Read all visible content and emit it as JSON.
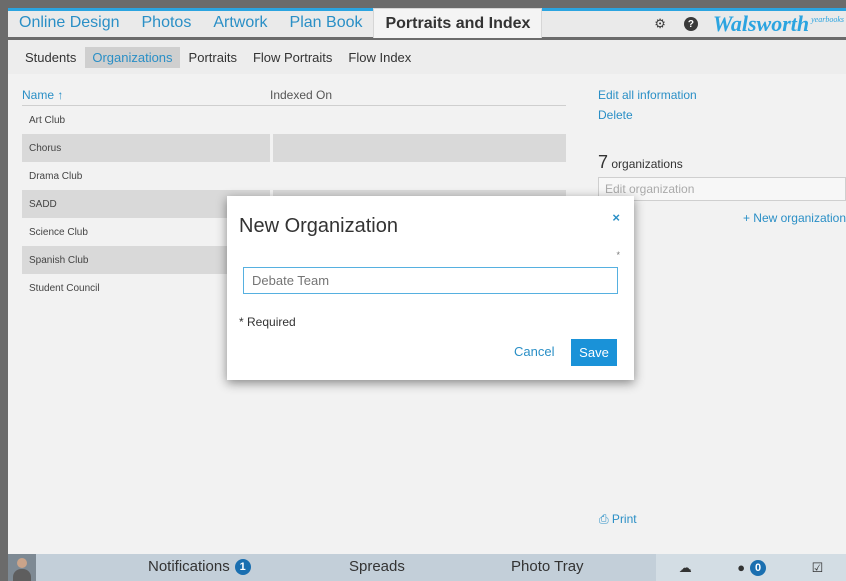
{
  "topnav": {
    "tabs": [
      "Online Design",
      "Photos",
      "Artwork",
      "Plan Book",
      "Portraits and Index"
    ],
    "active_tab": "Portraits and Index",
    "brand": "Walsworth",
    "brand_sub": "yearbooks",
    "icons": [
      "gear-icon",
      "help-icon"
    ]
  },
  "subnav": {
    "tabs": [
      "Students",
      "Organizations",
      "Portraits",
      "Flow Portraits",
      "Flow Index"
    ],
    "active_tab": "Organizations"
  },
  "table": {
    "headers": [
      "Name ↑",
      "Indexed On"
    ],
    "rows": [
      "Art Club",
      "Chorus",
      "Drama Club",
      "SADD",
      "Science Club",
      "Spanish Club",
      "Student Council"
    ]
  },
  "side": {
    "edit_all": "Edit all information",
    "delete": "Delete",
    "count_num": "7",
    "count_label": "organizations",
    "edit_org_placeholder": "Edit organization",
    "new_org": "+ New organization",
    "print": "⎙ Print"
  },
  "modal": {
    "title": "New Organization",
    "close": "×",
    "required_marker": "*",
    "field_placeholder": "Debate Team",
    "required_note": "* Required",
    "cancel": "Cancel",
    "save": "Save"
  },
  "bottombar": {
    "notifications": "Notifications",
    "notifications_count": "1",
    "spreads": "Spreads",
    "photo_tray": "Photo Tray",
    "upload_icon": "☁",
    "comments_icon": "●",
    "comments_count": "0",
    "tasks_icon": "☑"
  },
  "colors": {
    "accent": "#2a8fc6",
    "save_button": "#1a92d8",
    "top_border": "#2ba4e0"
  }
}
